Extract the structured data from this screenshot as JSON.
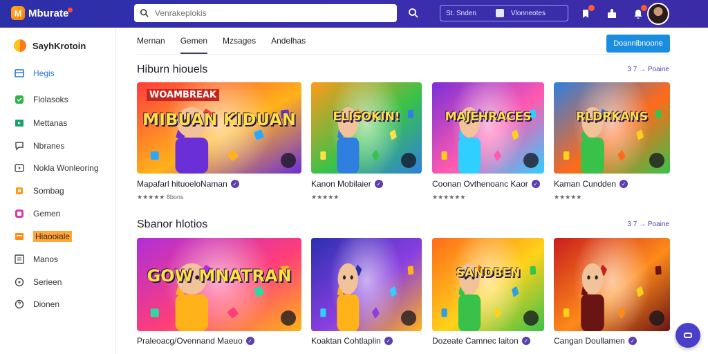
{
  "app": {
    "logo_text": "Mburate",
    "logo_mark": "M"
  },
  "search": {
    "placeholder": "Venrakeplokis"
  },
  "stats_bar": {
    "left": "St. Snden",
    "right": "Vlonneotes"
  },
  "sidebar": {
    "header": "SayhKrotoin",
    "items": [
      {
        "label": "Hegis",
        "icon": "grid-icon"
      },
      {
        "label": "Flolasoks",
        "icon": "puzzle-icon"
      },
      {
        "label": "Mettanas",
        "icon": "gamepad-icon"
      },
      {
        "label": "Nbranes",
        "icon": "chat-icon"
      },
      {
        "label": "Nokla Wonleoring",
        "icon": "video-icon"
      },
      {
        "label": "Sombag",
        "icon": "bag-icon"
      },
      {
        "label": "Gemen",
        "icon": "store-icon"
      },
      {
        "label": "Hiaooiale",
        "icon": "folder-icon"
      },
      {
        "label": "Manos",
        "icon": "list-icon"
      },
      {
        "label": "Serieen",
        "icon": "settings-icon"
      },
      {
        "label": "Dionen",
        "icon": "help-icon"
      }
    ]
  },
  "tabs": [
    "Mernan",
    "Gemen",
    "Mzsages",
    "Andelhas"
  ],
  "cta_label": "Doannibnoone",
  "sections": [
    {
      "title": "Hiburn hiouels",
      "link": "3 7 → Poaine",
      "cards": [
        {
          "title": "Mapafarl hituoeloNaman",
          "rating": "★★★★★ 8bons",
          "art_text": "MIBUAN KIDUAN",
          "art_banner": "WOAMBREAK"
        },
        {
          "title": "Kanon Mobilaier",
          "rating": "★★★★★",
          "art_text": "ELISOKIN!",
          "art_banner": ""
        },
        {
          "title": "Coonan Ovthenoanc Kaor",
          "rating": "★★★★★★",
          "art_text": "MAJEHRACES",
          "art_banner": ""
        },
        {
          "title": "Kaman Cundden",
          "rating": "★★★★★",
          "art_text": "RLDRKANS",
          "art_banner": ""
        }
      ]
    },
    {
      "title": "Sbanor hlotios",
      "link": "3 7 → Poaine",
      "cards": [
        {
          "title": "Praleoacg/Ovennand Maeuo",
          "rating": "★★★★★ ★",
          "art_text": "GOW MNATRAN",
          "art_banner": ""
        },
        {
          "title": "Koaktan Cohtlaplin",
          "rating": "★★★★★",
          "art_text": "",
          "art_banner": ""
        },
        {
          "title": "Dozeate Camnec laiton",
          "rating": "★★★★★",
          "art_text": "SANDBEN",
          "art_banner": ""
        },
        {
          "title": "Cangan Doullamen",
          "rating": "★★★★★",
          "art_text": "",
          "art_banner": ""
        }
      ]
    }
  ],
  "colors": {
    "topbar": "#2b2fa8",
    "accent": "#1a8de0",
    "link": "#4b3fb8",
    "verified": "#5b3fb0"
  }
}
